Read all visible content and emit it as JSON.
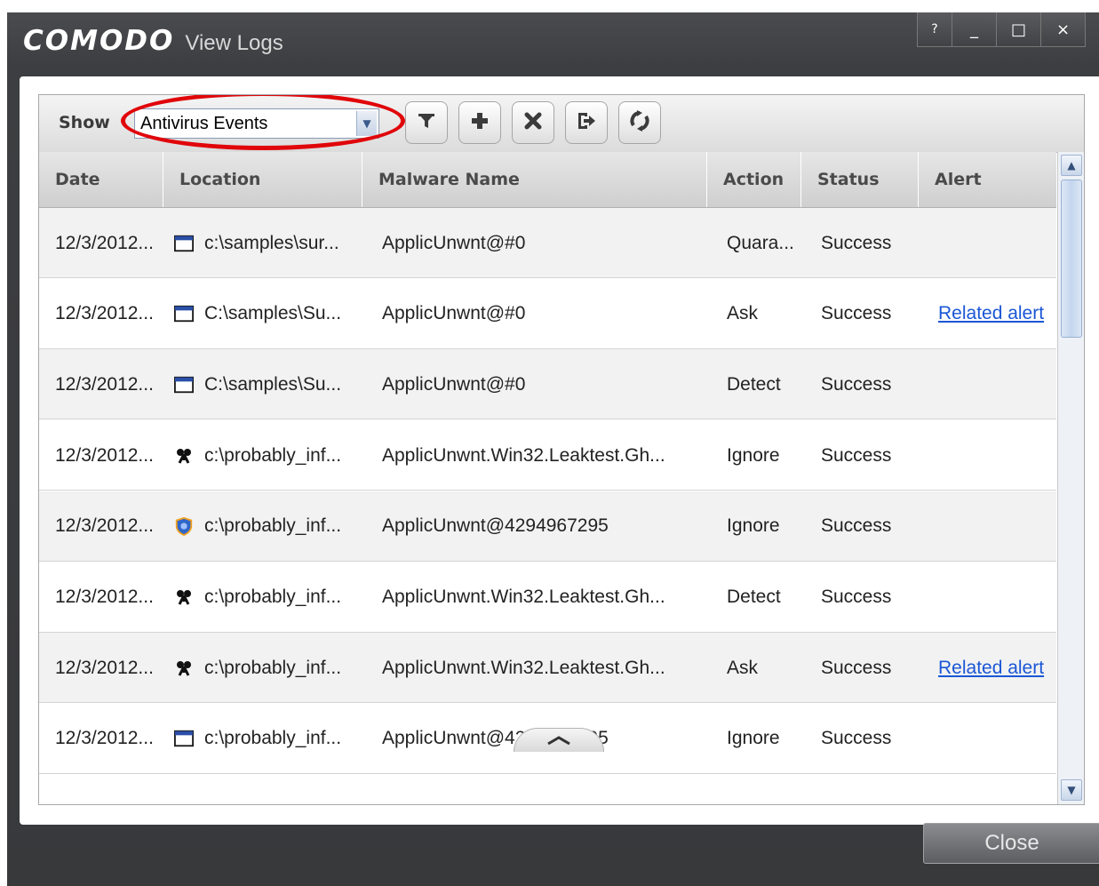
{
  "window": {
    "brand": "COMODO",
    "title": "View Logs",
    "controls": [
      "?",
      "_",
      "□",
      "×"
    ]
  },
  "toolbar": {
    "show_label": "Show",
    "select_value": "Antivirus Events",
    "buttons": [
      "filter-icon",
      "add-icon",
      "delete-icon",
      "export-icon",
      "refresh-icon"
    ],
    "highlight_color": "#e0060a"
  },
  "table": {
    "columns": [
      "Date",
      "Location",
      "Malware Name",
      "Action",
      "Status",
      "Alert"
    ],
    "rows": [
      {
        "date": "12/3/2012...",
        "icon": "window-icon",
        "location": "c:\\samples\\sur...",
        "malware": "ApplicUnwnt@#0",
        "action": "Quara...",
        "status": "Success",
        "alert": ""
      },
      {
        "date": "12/3/2012...",
        "icon": "window-icon",
        "location": "C:\\samples\\Su...",
        "malware": "ApplicUnwnt@#0",
        "action": "Ask",
        "status": "Success",
        "alert": "Related alert"
      },
      {
        "date": "12/3/2012...",
        "icon": "window-icon",
        "location": "C:\\samples\\Su...",
        "malware": "ApplicUnwnt@#0",
        "action": "Detect",
        "status": "Success",
        "alert": ""
      },
      {
        "date": "12/3/2012...",
        "icon": "bug-icon",
        "location": "c:\\probably_inf...",
        "malware": "ApplicUnwnt.Win32.Leaktest.Gh...",
        "action": "Ignore",
        "status": "Success",
        "alert": ""
      },
      {
        "date": "12/3/2012...",
        "icon": "shield-icon",
        "location": "c:\\probably_inf...",
        "malware": "ApplicUnwnt@4294967295",
        "action": "Ignore",
        "status": "Success",
        "alert": ""
      },
      {
        "date": "12/3/2012...",
        "icon": "bug-icon",
        "location": "c:\\probably_inf...",
        "malware": "ApplicUnwnt.Win32.Leaktest.Gh...",
        "action": "Detect",
        "status": "Success",
        "alert": ""
      },
      {
        "date": "12/3/2012...",
        "icon": "bug-icon",
        "location": "c:\\probably_inf...",
        "malware": "ApplicUnwnt.Win32.Leaktest.Gh...",
        "action": "Ask",
        "status": "Success",
        "alert": "Related alert"
      },
      {
        "date": "12/3/2012...",
        "icon": "window-icon",
        "location": "c:\\probably_inf...",
        "malware": "ApplicUnwnt@4294967295",
        "action": "Ignore",
        "status": "Success",
        "alert": ""
      }
    ]
  },
  "footer": {
    "close_label": "Close"
  }
}
